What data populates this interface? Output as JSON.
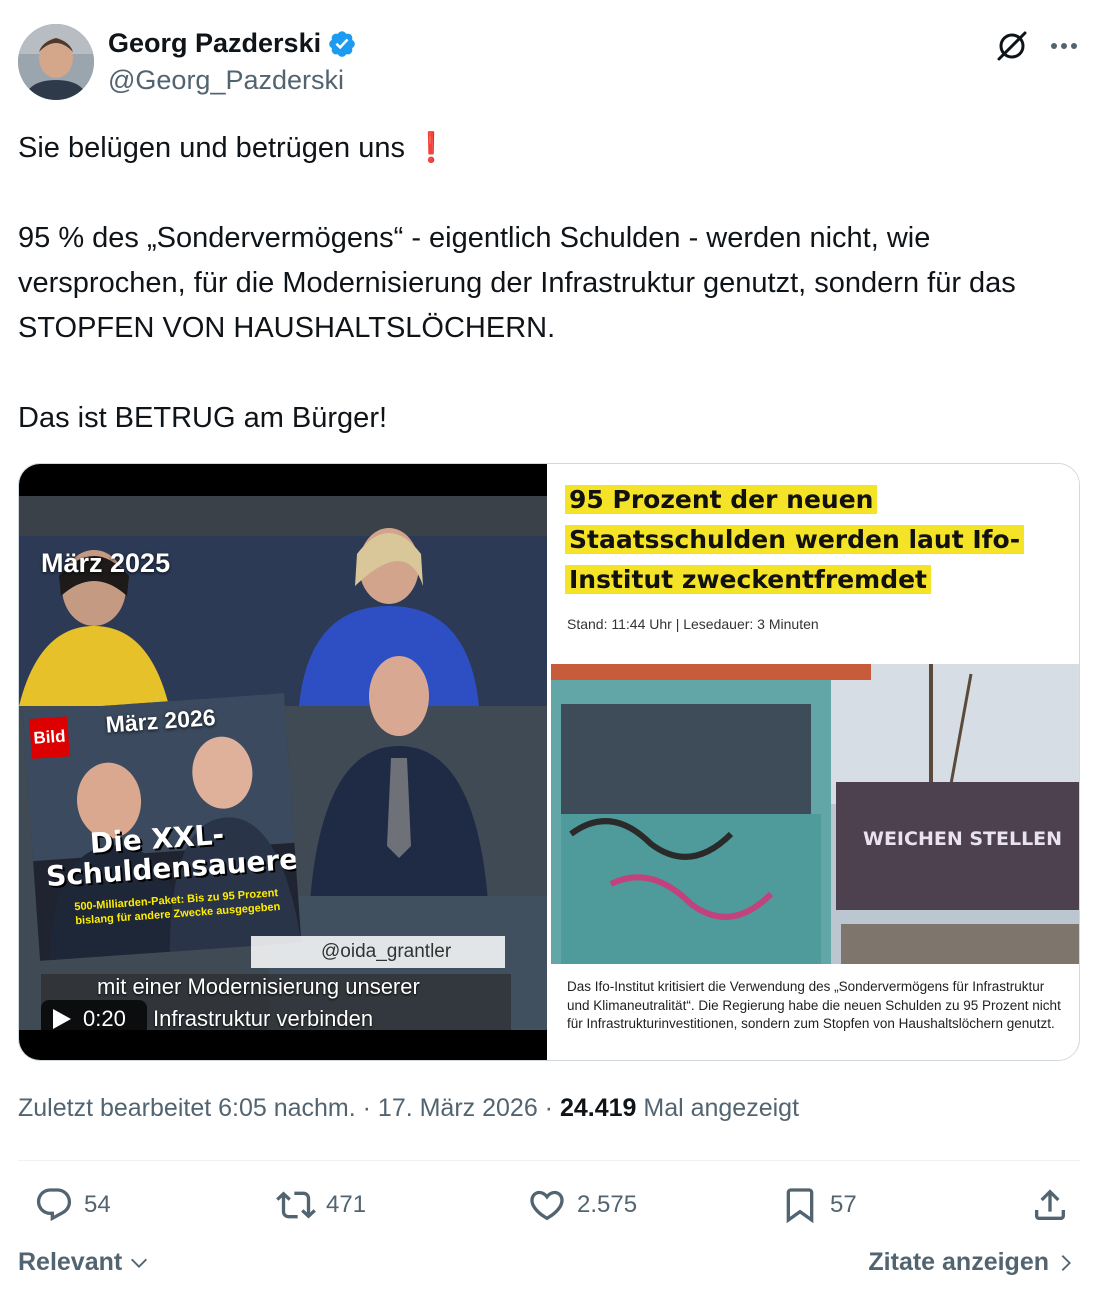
{
  "author": {
    "display_name": "Georg Pazderski",
    "handle": "@Georg_Pazderski",
    "avatar_icon": "profile-photo",
    "verified_color": "#1d9bf0"
  },
  "header_icons": {
    "grok": "grok-icon",
    "more": "more-horizontal-icon"
  },
  "tweet": {
    "line1": "Sie belügen und betrügen uns ",
    "line1_emoji": "❗",
    "paragraph2": "95 % des „Sondervermögens“ - eigentlich Schulden - werden nicht, wie versprochen, für die Modernisierung der Infrastruktur genutzt, sondern für das STOPFEN VON HAUSHALTSLÖCHERN.",
    "paragraph3": "Das ist BETRUG am Bürger!"
  },
  "media": {
    "video": {
      "label_top": "März 2025",
      "bild_logo": "Bild",
      "label_inset": "März 2026",
      "bild_headline_1": "Die XXL-",
      "bild_headline_2": "Schuldensauerei",
      "bild_subline": "500-Milliarden-Paket: Bis zu 95 Prozent bislang für andere Zwecke ausgegeben",
      "handle_overlay": "@oida_grantler",
      "subtitle_1": "mit einer Modernisierung unserer",
      "subtitle_2": "Infrastruktur verbinden",
      "duration": "0:20",
      "play_icon": "play-icon"
    },
    "article": {
      "title_1": "95 Prozent der neuen",
      "title_2": "Staatsschulden werden laut Ifo-",
      "title_3": "Institut zweckentfremdet",
      "highlight_color": "#f4e326",
      "meta": "Stand: 11:44 Uhr  |  Lesedauer: 3 Minuten",
      "sign_text": "WEICHEN STELLEN",
      "caption": "Das Ifo-Institut kritisiert die Verwendung des „Sondervermögens für Infrastruktur und Klimaneutralität“. Die Regierung habe die neuen Schulden zu 95 Prozent nicht für Infrastrukturinvestitionen, sondern zum Stopfen von Haushaltslöchern genutzt."
    }
  },
  "meta": {
    "edited_time": "Zuletzt bearbeitet 6:05 nachm. · 17. März 2026 · ",
    "views": "24.419",
    "views_suffix": " Mal angezeigt"
  },
  "actions": {
    "replies": "54",
    "reposts": "471",
    "likes": "2.575",
    "bookmarks": "57",
    "reply_icon": "reply-icon",
    "repost_icon": "repost-icon",
    "like_icon": "heart-icon",
    "bookmark_icon": "bookmark-icon",
    "share_icon": "share-icon"
  },
  "footer": {
    "sort_label": "Relevant",
    "quotes_label": "Zitate anzeigen"
  }
}
